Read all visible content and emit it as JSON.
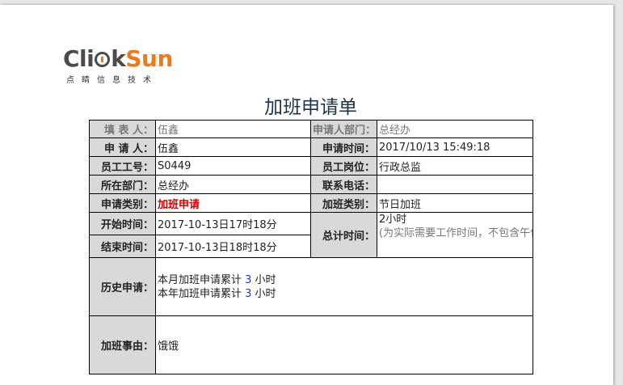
{
  "logo": {
    "brand_click": "Cli",
    "brand_k": "k",
    "brand_sun": "Sun",
    "tagline": "点睛信息技术"
  },
  "form": {
    "title": "加班申请单",
    "labels": {
      "filler": "填 表 人：",
      "applicant_dept": "申请人部门：",
      "applicant": "申 请 人：",
      "apply_time": "申请时间：",
      "employee_no": "员工工号：",
      "position": "员工岗位：",
      "department": "所在部门：",
      "phone": "联系电话：",
      "apply_type": "申请类别：",
      "overtime_type": "加班类别：",
      "start_time": "开始时间：",
      "end_time": "结束时间：",
      "total_time": "总计时间：",
      "history": "历史申请：",
      "reason": "加班事由："
    },
    "values": {
      "filler": "伍鑫",
      "applicant_dept": "总经办",
      "applicant": "伍鑫",
      "apply_time": "2017/10/13 15:49:18",
      "employee_no": "S0449",
      "position": "行政总监",
      "department": "总经办",
      "phone": "",
      "apply_type": "加班申请",
      "overtime_type": "节日加班",
      "start_time": "2017-10-13日17时18分",
      "end_time": "2017-10-13日18时18分",
      "total_hours": "2小时",
      "total_note": "(为实际需要工作时间，不包含午休和晚上等非上班时间)",
      "history_month_prefix": "本月加班申请累计 ",
      "history_month_count": "3",
      "history_year_prefix": "本年加班申请累计 ",
      "history_year_count": "3",
      "history_unit": " 小时",
      "reason": "饿饿"
    },
    "colors": {
      "label_bg": "#d9d9d9",
      "highlight_red": "#d40000",
      "count_blue": "#1a3bd6",
      "logo_orange": "#ee7a1e"
    }
  }
}
